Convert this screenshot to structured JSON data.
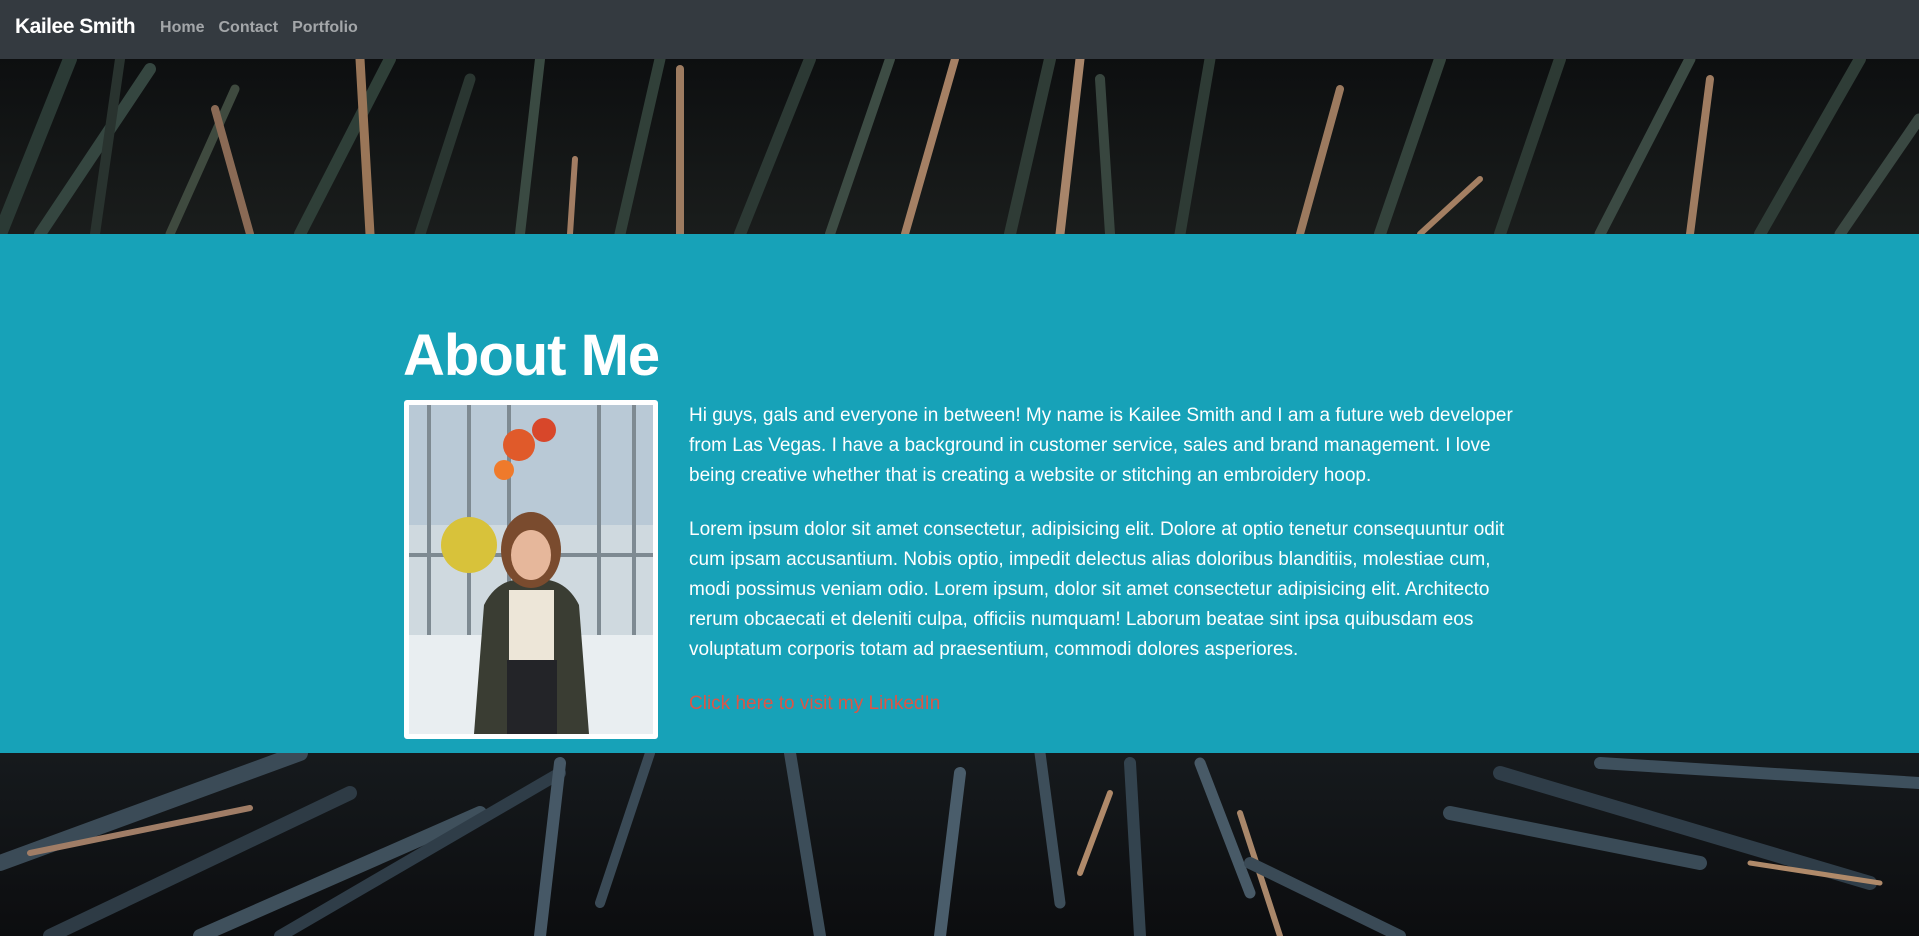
{
  "nav": {
    "brand": "Kailee Smith",
    "links": [
      "Home",
      "Contact",
      "Portfolio"
    ]
  },
  "about": {
    "title": "About Me",
    "paragraph1": "Hi guys, gals and everyone in between! My name is Kailee Smith and I am a future web developer from Las Vegas. I have a background in customer service, sales and brand management. I love being creative whether that is creating a website or stitching an embroidery hoop.",
    "paragraph2": "Lorem ipsum dolor sit amet consectetur, adipisicing elit. Dolore at optio tenetur consequuntur odit cum ipsam accusantium. Nobis optio, impedit delectus alias doloribus blanditiis, molestiae cum, modi possimus veniam odio. Lorem ipsum, dolor sit amet consectetur adipisicing elit. Architecto rerum obcaecati et deleniti culpa, officiis numquam! Laborum beatae sint ipsa quibusdam eos voluptatum corporis totam ad praesentium, commodi dolores asperiores.",
    "linkedin_label": "Click here to visit my LinkedIn"
  },
  "colors": {
    "navbar": "#343a40",
    "accent": "#17a2b8",
    "link": "#dc5546"
  }
}
